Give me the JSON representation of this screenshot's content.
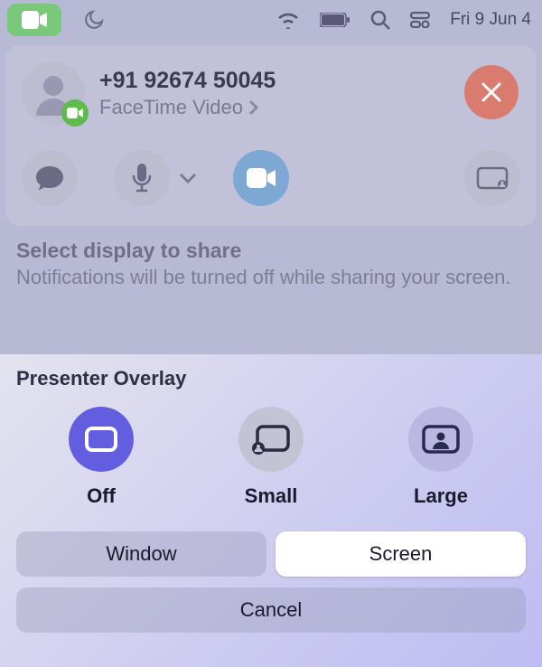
{
  "menubar": {
    "date": "Fri 9 Jun 4"
  },
  "call": {
    "number": "+91 92674 50045",
    "subtitle": "FaceTime Video"
  },
  "share": {
    "title": "Select display to share",
    "desc": "Notifications will be turned off while sharing your screen."
  },
  "overlay": {
    "title": "Presenter Overlay",
    "options": {
      "off": "Off",
      "small": "Small",
      "large": "Large"
    },
    "segments": {
      "window": "Window",
      "screen": "Screen"
    },
    "cancel": "Cancel"
  }
}
